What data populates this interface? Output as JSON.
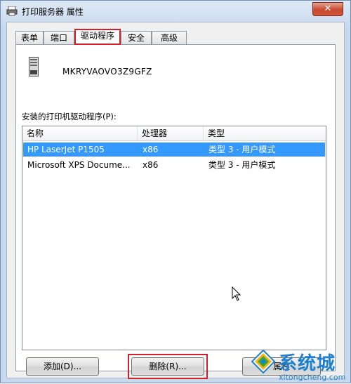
{
  "window": {
    "title": "打印服务器 属性",
    "close_glyph": "✕"
  },
  "tabs": [
    {
      "label": "表单"
    },
    {
      "label": "端口"
    },
    {
      "label": "驱动程序"
    },
    {
      "label": "安全"
    },
    {
      "label": "高级"
    }
  ],
  "active_tab": "驱动程序",
  "server": {
    "name": "MKRYVAOVO3Z9GFZ"
  },
  "drivers": {
    "label": "安装的打印机驱动程序(P):",
    "columns": [
      "名称",
      "处理器",
      "类型"
    ],
    "rows": [
      {
        "name": "HP LaserJet P1505",
        "processor": "x86",
        "type": "类型 3 - 用户模式",
        "selected": true
      },
      {
        "name": "Microsoft XPS Docume...",
        "processor": "x86",
        "type": "类型 3 - 用户模式",
        "selected": false
      }
    ]
  },
  "buttons": {
    "add": "添加(D)...",
    "remove": "删除(R)...",
    "properties": "属性"
  },
  "watermark": {
    "brand": "系统城",
    "url": "xitongcheng.com"
  },
  "colors": {
    "selection": "#3399ff",
    "highlight_box": "#d21f2b",
    "watermark": "#1d7fd0"
  }
}
